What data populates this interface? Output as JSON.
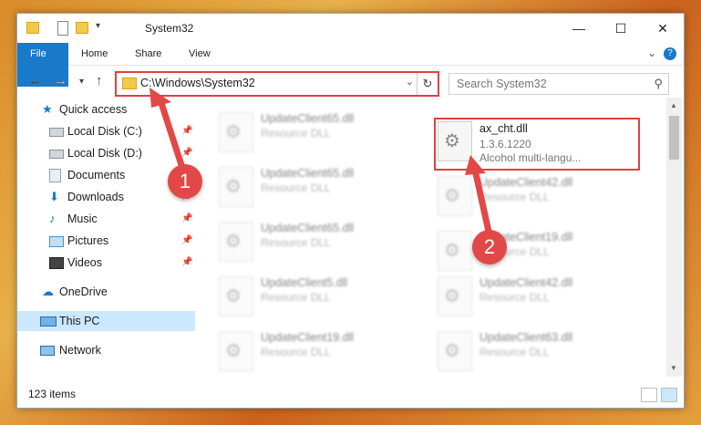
{
  "window": {
    "title": "System32",
    "tabs": [
      "File",
      "Home",
      "Share",
      "View"
    ]
  },
  "address": {
    "path": "C:\\Windows\\System32"
  },
  "search": {
    "placeholder": "Search System32"
  },
  "nav": {
    "items": [
      {
        "label": "Quick access",
        "icon": "star-icon",
        "pinned": false
      },
      {
        "label": "Local Disk (C:)",
        "icon": "drive-icon",
        "pinned": true
      },
      {
        "label": "Local Disk (D:)",
        "icon": "drive-icon",
        "pinned": true
      },
      {
        "label": "Documents",
        "icon": "documents-icon",
        "pinned": true
      },
      {
        "label": "Downloads",
        "icon": "download-icon",
        "pinned": true
      },
      {
        "label": "Music",
        "icon": "music-icon",
        "pinned": true
      },
      {
        "label": "Pictures",
        "icon": "pictures-icon",
        "pinned": true
      },
      {
        "label": "Videos",
        "icon": "videos-icon",
        "pinned": true
      },
      {
        "label": "OneDrive",
        "icon": "cloud-icon",
        "pinned": false
      },
      {
        "label": "This PC",
        "icon": "computer-icon",
        "pinned": false
      },
      {
        "label": "Network",
        "icon": "network-icon",
        "pinned": false
      }
    ]
  },
  "files": {
    "left": [
      {
        "name": "UpdateClient65.dll",
        "type": "Resource DLL"
      },
      {
        "name": "UpdateClient65.dll",
        "type": "Resource DLL"
      },
      {
        "name": "UpdateClient65.dll",
        "type": "Resource DLL"
      },
      {
        "name": "UpdateClient5.dll",
        "type": "Resource DLL"
      },
      {
        "name": "UpdateClient19.dll",
        "type": "Resource DLL"
      }
    ],
    "right": [
      {
        "name": "ax_cht.dll",
        "type": "1.3.6.1220",
        "desc": "Alcohol multi-langu..."
      },
      {
        "name": "UpdateClient42.dll",
        "type": "Resource DLL"
      },
      {
        "name": "UpdateClient19.dll",
        "type": "Resource DLL"
      },
      {
        "name": "UpdateClient42.dll",
        "type": "Resource DLL"
      },
      {
        "name": "UpdateClient63.dll",
        "type": "Resource DLL"
      }
    ]
  },
  "status": {
    "count": "123 items"
  },
  "annotations": {
    "badge1": "1",
    "badge2": "2"
  },
  "colors": {
    "accent": "#1979ca",
    "highlight": "#e04040",
    "selection": "#cce8ff"
  }
}
